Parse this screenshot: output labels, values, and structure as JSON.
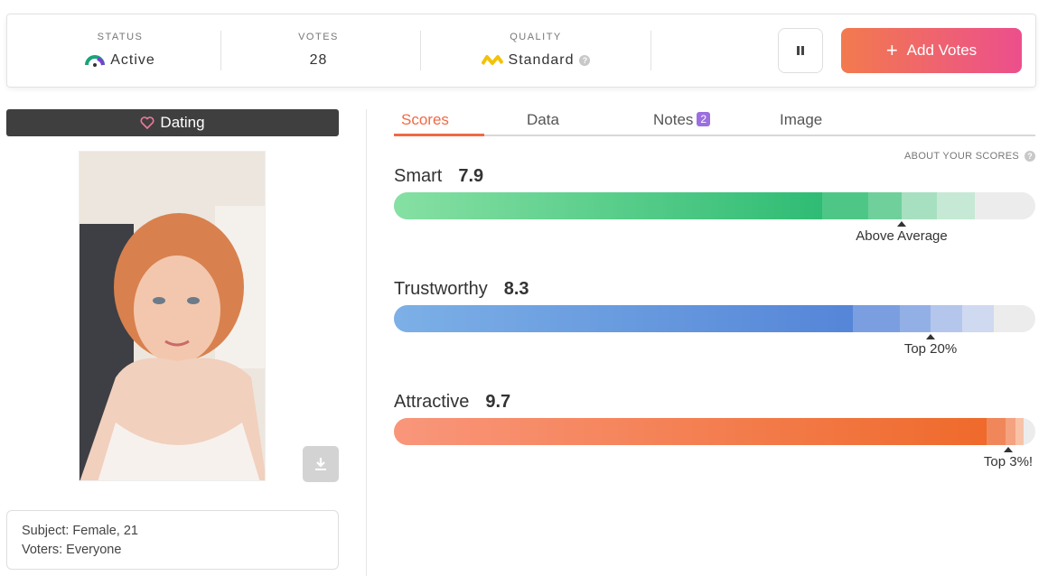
{
  "status_bar": {
    "status": {
      "label": "STATUS",
      "value": "Active"
    },
    "votes": {
      "label": "VOTES",
      "value": "28"
    },
    "quality": {
      "label": "QUALITY",
      "value": "Standard",
      "help": "?"
    },
    "add_votes_label": "Add Votes",
    "add_votes_icon": "+"
  },
  "category": {
    "label": "Dating",
    "icon": "heart-icon"
  },
  "subject": {
    "line1": "Subject: Female, 21",
    "line2": "Voters: Everyone"
  },
  "tabs": [
    {
      "label": "Scores",
      "active": true
    },
    {
      "label": "Data",
      "active": false
    },
    {
      "label": "Notes",
      "badge": "2",
      "active": false
    },
    {
      "label": "Image",
      "active": false
    }
  ],
  "about_scores": {
    "label": "ABOUT YOUR SCORES",
    "help": "?"
  },
  "scores": [
    {
      "name": "Smart",
      "value": "7.9",
      "percentile_label": "Above Average",
      "colors": [
        "#86e0a3",
        "#2fbc74"
      ]
    },
    {
      "name": "Trustworthy",
      "value": "8.3",
      "percentile_label": "Top 20%",
      "colors": [
        "#7cb0e6",
        "#5585d8"
      ]
    },
    {
      "name": "Attractive",
      "value": "9.7",
      "percentile_label": "Top 3%!",
      "colors": [
        "#f9967b",
        "#ef6a2b"
      ]
    }
  ],
  "accent_colors": {
    "brand_orange": "#f06a45",
    "brand_pink": "#ec4f8c",
    "badge_purple": "#9b6fe0"
  }
}
